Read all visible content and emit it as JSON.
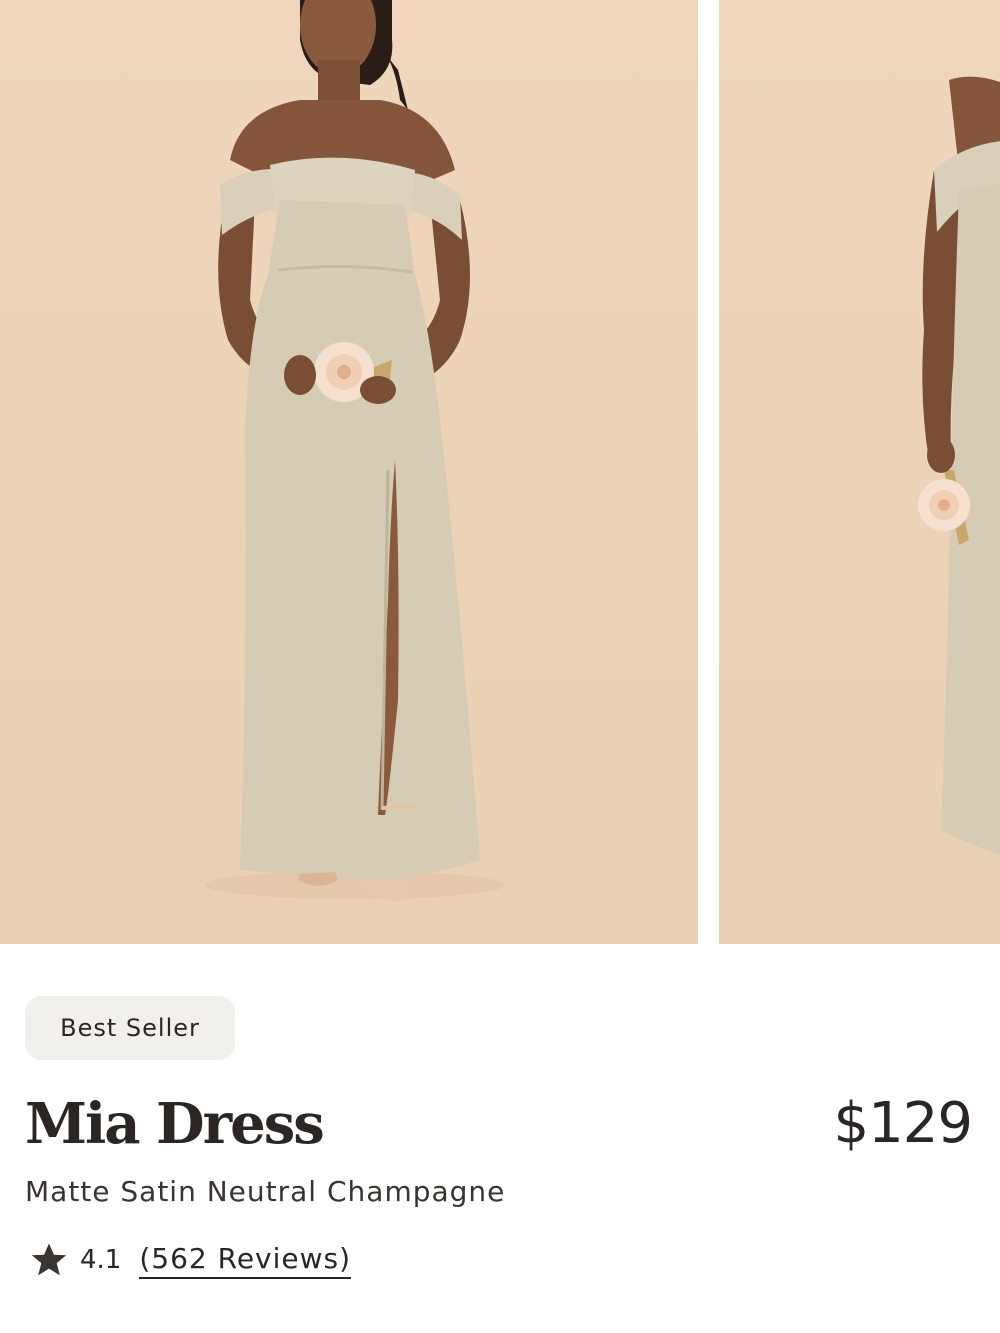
{
  "product": {
    "badge": "Best Seller",
    "name": "Mia Dress",
    "price": "$129",
    "variant": "Matte Satin Neutral Champagne",
    "rating": "4.1",
    "reviews_label": "(562 Reviews)"
  },
  "gallery": {
    "images": [
      {
        "name": "front-view-photo"
      },
      {
        "name": "side-view-photo"
      }
    ]
  },
  "icons": {
    "rating_star": "star-icon"
  },
  "colors": {
    "text": "#2b2624",
    "badge_background": "#f2f0ed",
    "photo_background": "#eed4ba",
    "dress": "#d6ccb6"
  }
}
